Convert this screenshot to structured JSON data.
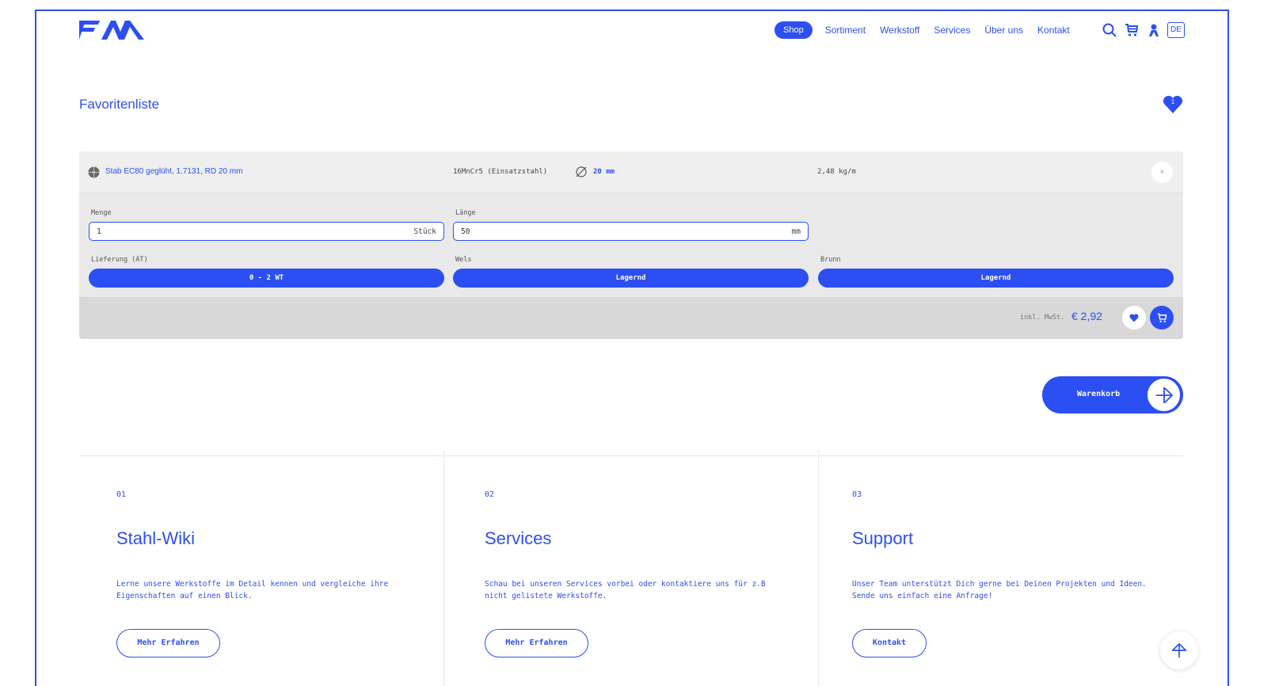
{
  "brand": {
    "logo_text": "FM",
    "accent": "#2b4ff2"
  },
  "nav": {
    "active": "Shop",
    "items": [
      "Sortiment",
      "Werkstoff",
      "Services",
      "Über uns",
      "Kontakt"
    ],
    "icons": [
      "search-icon",
      "cart-icon",
      "user-icon"
    ],
    "language": "DE"
  },
  "page": {
    "title": "Favoritenliste",
    "favorites_count": "1"
  },
  "item": {
    "name": "Stab EC80 geglüht, 1.7131, RD 20 mm",
    "material": "16MnCr5 (Einsatzstahl)",
    "diameter": "20 mm",
    "weight": "2,48 kg/m",
    "close": "×",
    "menge_label": "Menge",
    "menge_value": "1",
    "menge_unit": "Stück",
    "laenge_label": "Länge",
    "laenge_value": "50",
    "laenge_unit": "mm",
    "lieferung_label": "Lieferung (AT)",
    "lieferung_value": "0 - 2 WT",
    "wels_label": "Wels",
    "wels_value": "Lagernd",
    "brunn_label": "Brunn",
    "brunn_value": "Lagernd",
    "inkl": "inkl. MwSt.",
    "price": "€ 2,92"
  },
  "basket": {
    "label": "Warenkorb"
  },
  "columns": [
    {
      "num": "01",
      "title": "Stahl-Wiki",
      "text": "Lerne unsere Werkstoffe im Detail kennen und vergleiche ihre Eigenschaften auf einen Blick.",
      "button": "Mehr Erfahren"
    },
    {
      "num": "02",
      "title": "Services",
      "text": "Schau bei unseren Services vorbei oder kontaktiere uns für z.B nicht gelistete Werkstoffe.",
      "button": "Mehr Erfahren"
    },
    {
      "num": "03",
      "title": "Support",
      "text": "Unser Team unterstützt Dich gerne bei Deinen Projekten und Ideen. Sende uns einfach eine Anfrage!",
      "button": "Kontakt"
    }
  ]
}
